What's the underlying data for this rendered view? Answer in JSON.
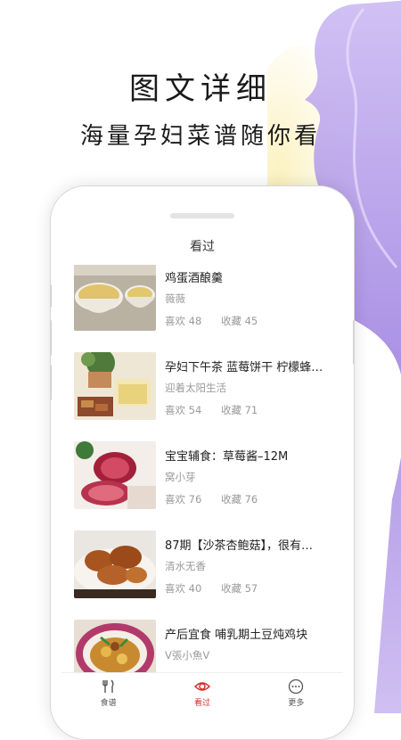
{
  "promo": {
    "headline": "图文详细",
    "subheadline": "海量孕妇菜谱随你看"
  },
  "screen": {
    "title": "看过",
    "likes_label": "喜欢",
    "favorites_label": "收藏",
    "items": [
      {
        "title": "鸡蛋酒酿羹",
        "author": "薇薇",
        "likes": "48",
        "favorites": "45"
      },
      {
        "title": "孕妇下午茶  蓝莓饼干 柠檬蜂…",
        "author": "迎着太阳生活",
        "likes": "54",
        "favorites": "71"
      },
      {
        "title": "宝宝辅食：草莓酱–12M",
        "author": "窝小芽",
        "likes": "76",
        "favorites": "76"
      },
      {
        "title": "87期【沙茶杏鲍菇】，很有…",
        "author": "清水无香",
        "likes": "40",
        "favorites": "57"
      },
      {
        "title": "产后宜食 哺乳期土豆炖鸡块",
        "author": "V張小魚V",
        "likes": "",
        "favorites": ""
      }
    ]
  },
  "tabbar": {
    "tabs": [
      {
        "label": "食谱",
        "icon": "utensils-icon"
      },
      {
        "label": "看过",
        "icon": "eye-icon"
      },
      {
        "label": "更多",
        "icon": "more-icon"
      }
    ],
    "active_color": "#d2302c"
  },
  "colors": {
    "silhouette": "#b7a2e8",
    "glow": "#f6e7a0"
  }
}
